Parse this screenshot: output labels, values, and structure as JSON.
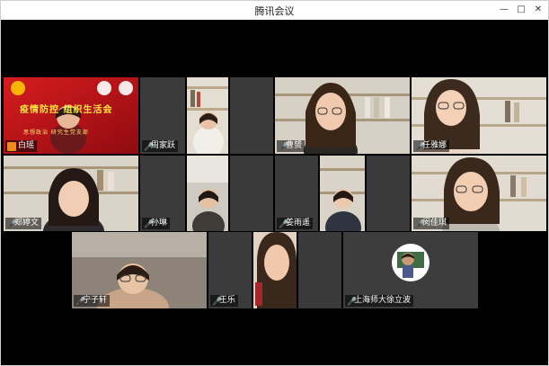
{
  "window": {
    "title": "腾讯会议"
  },
  "banner": {
    "headline": "疫情防控  组织生活会",
    "subline": "思想政治  研究生党支部"
  },
  "participants": [
    {
      "name": "白瑶",
      "muted": false
    },
    {
      "name": "周家跃",
      "muted": true
    },
    {
      "name": "",
      "muted": true
    },
    {
      "name": "",
      "muted": true
    },
    {
      "name": "曹赟",
      "muted": true
    },
    {
      "name": "任雅娜",
      "muted": true
    },
    {
      "name": "郑婷文",
      "muted": true
    },
    {
      "name": "孙琳",
      "muted": true
    },
    {
      "name": "",
      "muted": true
    },
    {
      "name": "姜雨遥",
      "muted": true
    },
    {
      "name": "闵佳琪",
      "muted": true
    },
    {
      "name": "宁子轩",
      "muted": true
    },
    {
      "name": "王乐",
      "muted": true
    },
    {
      "name": "上海师大徐立波",
      "muted": true
    }
  ],
  "colors": {
    "banner_red": "#c8161d",
    "mic_active": "#f08a1c",
    "background": "#000000"
  }
}
